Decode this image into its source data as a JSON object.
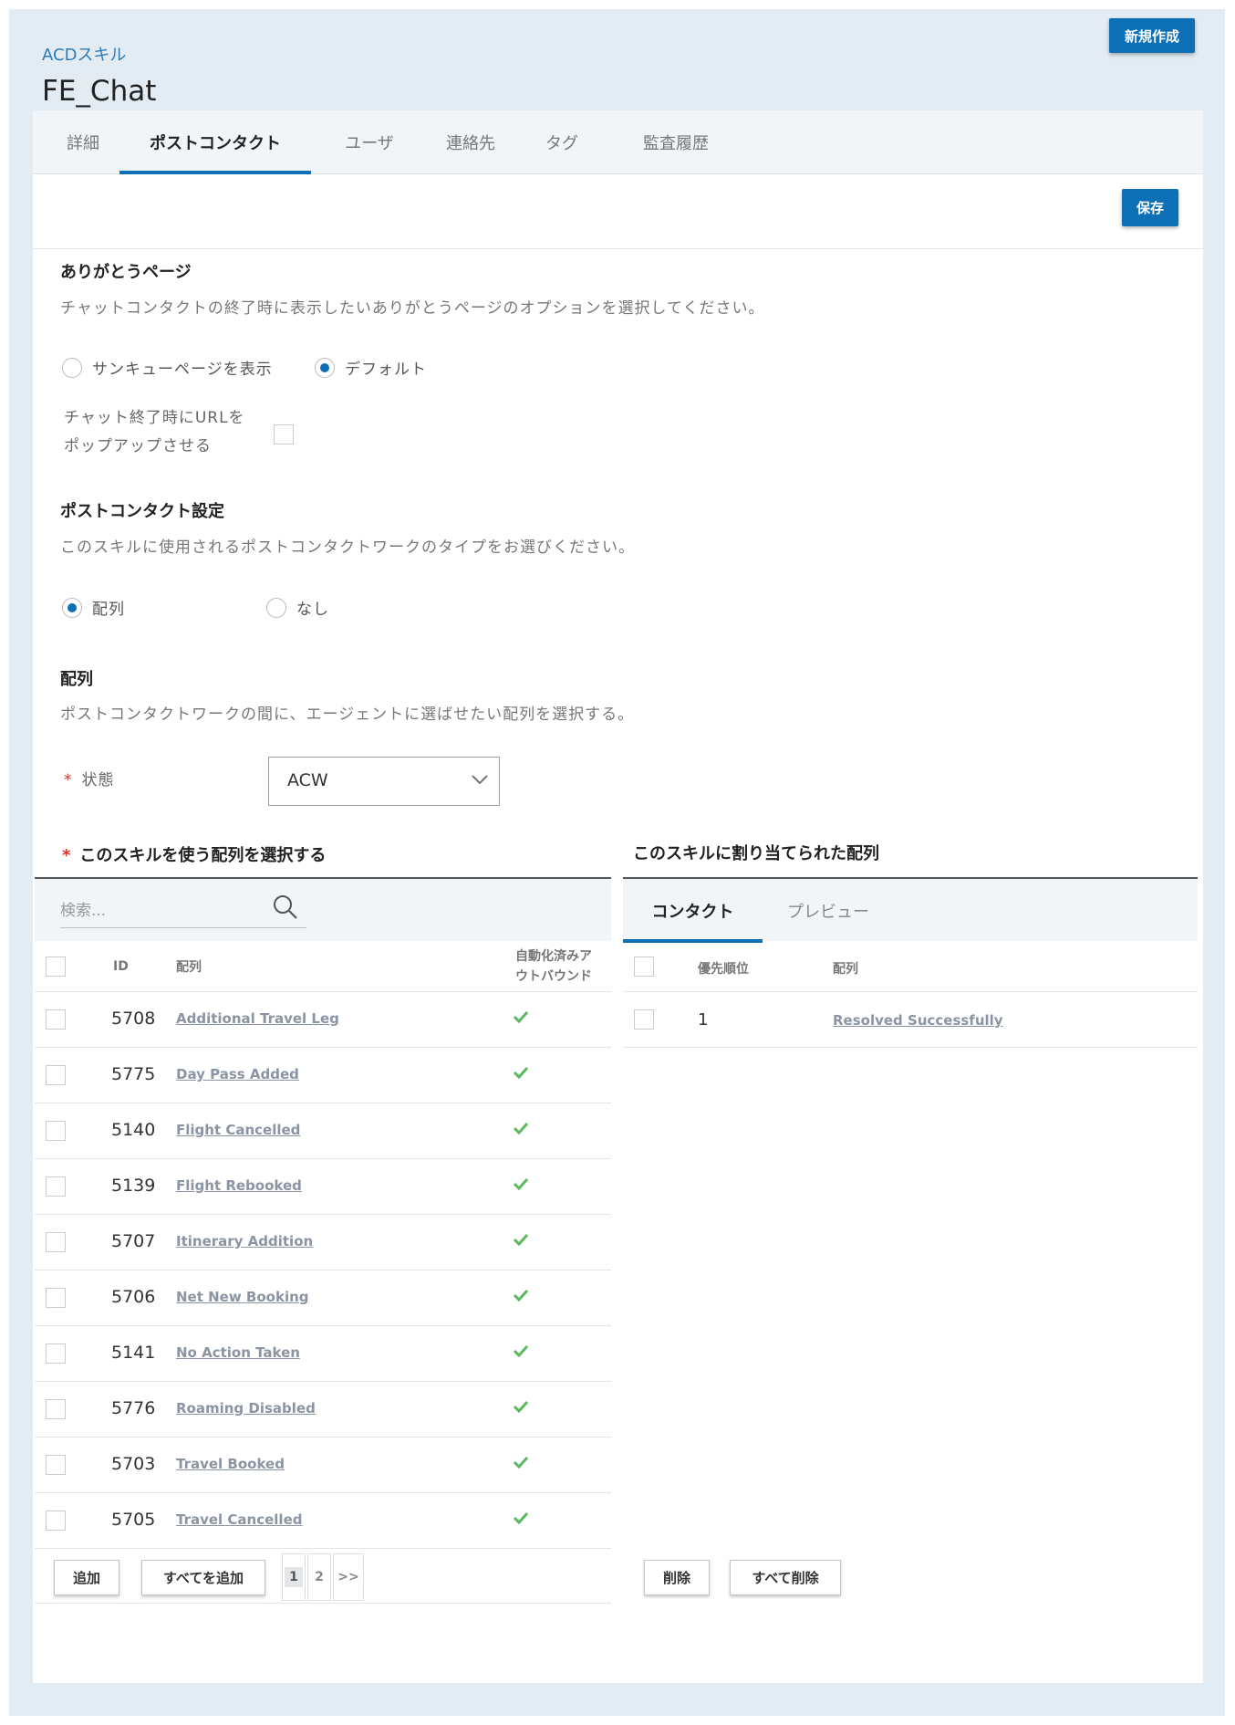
{
  "header": {
    "breadcrumb": "ACDスキル",
    "title": "FE_Chat",
    "new_button": "新規作成"
  },
  "tabs": [
    "詳細",
    "ポストコンタクト",
    "ユーザ",
    "連絡先",
    "タグ",
    "監査履歴"
  ],
  "save_button": "保存",
  "thanks": {
    "title": "ありがとうページ",
    "desc": "チャットコンタクトの終了時に表示したいありがとうページのオプションを選択してください。",
    "opt_show": "サンキューページを表示",
    "opt_default": "デフォルト",
    "popup_label_1": "チャット終了時にURLを",
    "popup_label_2": "ポップアップさせる"
  },
  "post": {
    "title": "ポストコンタクト設定",
    "desc": "このスキルに使用されるポストコンタクトワークのタイプをお選びください。",
    "opt_array": "配列",
    "opt_none": "なし"
  },
  "array": {
    "title": "配列",
    "desc": "ポストコンタクトワークの間に、エージェントに選ばせたい配列を選択する。",
    "required_mark": "*",
    "state_label": "状態",
    "state_value": "ACW"
  },
  "left": {
    "title": "このスキルを使う配列を選択する",
    "search_placeholder": "検索...",
    "col_id": "ID",
    "col_array": "配列",
    "col_auto_1": "自動化済みア",
    "col_auto_2": "ウトバウンド",
    "rows": [
      {
        "id": "5708",
        "name": "Additional Travel Leg"
      },
      {
        "id": "5775",
        "name": "Day Pass Added"
      },
      {
        "id": "5140",
        "name": "Flight Cancelled"
      },
      {
        "id": "5139",
        "name": "Flight Rebooked"
      },
      {
        "id": "5707",
        "name": "Itinerary Addition"
      },
      {
        "id": "5706",
        "name": "Net New Booking"
      },
      {
        "id": "5141",
        "name": "No Action Taken"
      },
      {
        "id": "5776",
        "name": "Roaming Disabled"
      },
      {
        "id": "5703",
        "name": "Travel Booked"
      },
      {
        "id": "5705",
        "name": "Travel Cancelled"
      }
    ],
    "pages": [
      "1",
      "2",
      ">>"
    ],
    "add_button": "追加",
    "add_all_button": "すべてを追加"
  },
  "right": {
    "title": "このスキルに割り当てられた配列",
    "tab_contact": "コンタクト",
    "tab_preview": "プレビュー",
    "col_priority": "優先順位",
    "col_array": "配列",
    "rows": [
      {
        "priority": "1",
        "name": "Resolved Successfully"
      }
    ],
    "delete_button": "削除",
    "delete_all_button": "すべて削除"
  },
  "colors": {
    "accent": "#0d6fb5",
    "link": "#2c7bb9",
    "check": "#5cb85c",
    "required": "#d9342b"
  }
}
